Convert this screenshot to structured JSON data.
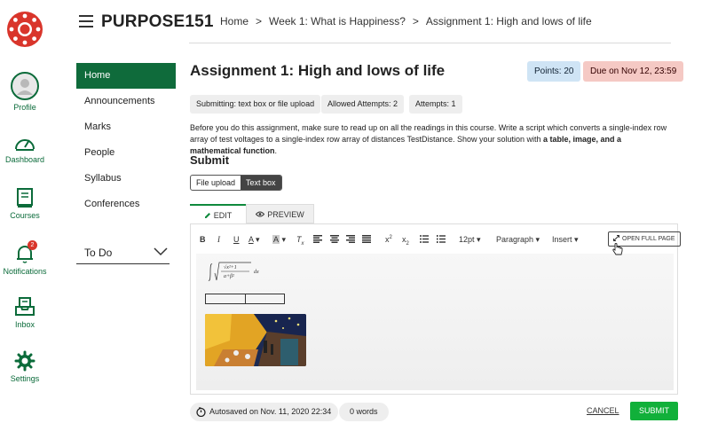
{
  "global_nav": {
    "items": [
      {
        "label": "Profile",
        "icon": "avatar-icon"
      },
      {
        "label": "Dashboard",
        "icon": "speedometer-icon"
      },
      {
        "label": "Courses",
        "icon": "book-icon"
      },
      {
        "label": "Notifications",
        "icon": "bell-icon",
        "badge": "2"
      },
      {
        "label": "Inbox",
        "icon": "inbox-icon"
      },
      {
        "label": "Settings",
        "icon": "gear-icon"
      }
    ]
  },
  "header": {
    "course_title": "PURPOSE151",
    "breadcrumbs": [
      "Home",
      "Week 1: What is Happiness?",
      "Assignment 1: High and lows of life"
    ]
  },
  "course_nav": {
    "items": [
      "Home",
      "Announcements",
      "Marks",
      "People",
      "Syllabus",
      "Conferences"
    ],
    "active": "Home",
    "todo_label": "To Do"
  },
  "assignment": {
    "title": "Assignment 1: High and lows of life",
    "points": "Points: 20",
    "due": "Due on Nov 12, 23:59",
    "chips": [
      "Submitting: text box or file upload",
      "Allowed Attempts: 2",
      "Attempts: 1"
    ],
    "description_plain": "Before you do this assignment, make sure to read up on all the readings in this course. Write a script which converts a single-index row array of test voltages to a single-index row array of distances TestDistance. Show your solution with ",
    "description_bold": "a table, image, and a mathematical function",
    "description_end": "."
  },
  "submit": {
    "heading": "Submit",
    "modes": [
      "File upload",
      "Text box"
    ],
    "selected_mode": "Text box"
  },
  "editor": {
    "tabs": [
      "EDIT",
      "PREVIEW"
    ],
    "active_tab": "EDIT",
    "font_size": "12pt",
    "block_format": "Paragraph",
    "insert_label": "Insert",
    "open_full_page": "OPEN FULL PAGE"
  },
  "footer": {
    "autosave": "Autosaved on Nov. 11, 2020 22:34",
    "word_count": "0 words",
    "cancel": "CANCEL",
    "submit": "SUBMIT"
  },
  "colors": {
    "brand_green": "#0f6b3b",
    "submit_green": "#11b03a",
    "logo_red": "#d9352b",
    "points_bg": "#cfe4f5",
    "due_bg": "#f5c9c4"
  }
}
